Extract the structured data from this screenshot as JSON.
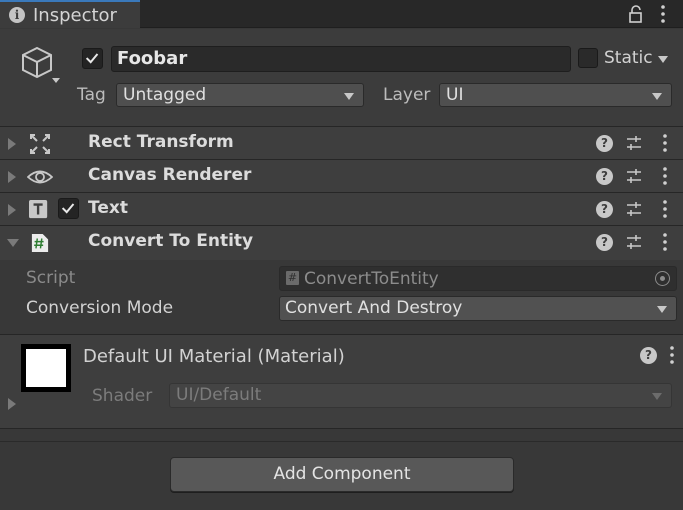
{
  "window": {
    "tab_label": "Inspector"
  },
  "header": {
    "object_name": "Foobar",
    "enabled": true,
    "static_label": "Static",
    "tag_label": "Tag",
    "tag_value": "Untagged",
    "layer_label": "Layer",
    "layer_value": "UI"
  },
  "components": [
    {
      "label": "Rect Transform",
      "icon": "rect-transform-icon",
      "expanded": false,
      "has_checkbox": false
    },
    {
      "label": "Canvas Renderer",
      "icon": "eye-icon",
      "expanded": false,
      "has_checkbox": false
    },
    {
      "label": "Text",
      "icon": "text-t-icon",
      "expanded": false,
      "has_checkbox": true,
      "checked": true
    },
    {
      "label": "Convert To Entity",
      "icon": "script-hash-icon",
      "expanded": true,
      "has_checkbox": false
    }
  ],
  "convert_to_entity": {
    "script_label": "Script",
    "script_value": "ConvertToEntity",
    "mode_label": "Conversion Mode",
    "mode_value": "Convert And Destroy"
  },
  "material": {
    "title": "Default UI Material (Material)",
    "shader_label": "Shader",
    "shader_value": "UI/Default"
  },
  "add_component_label": "Add Component",
  "colors": {
    "accent": "#3a79bb",
    "panel": "#383838",
    "header": "#3c3c3c"
  }
}
